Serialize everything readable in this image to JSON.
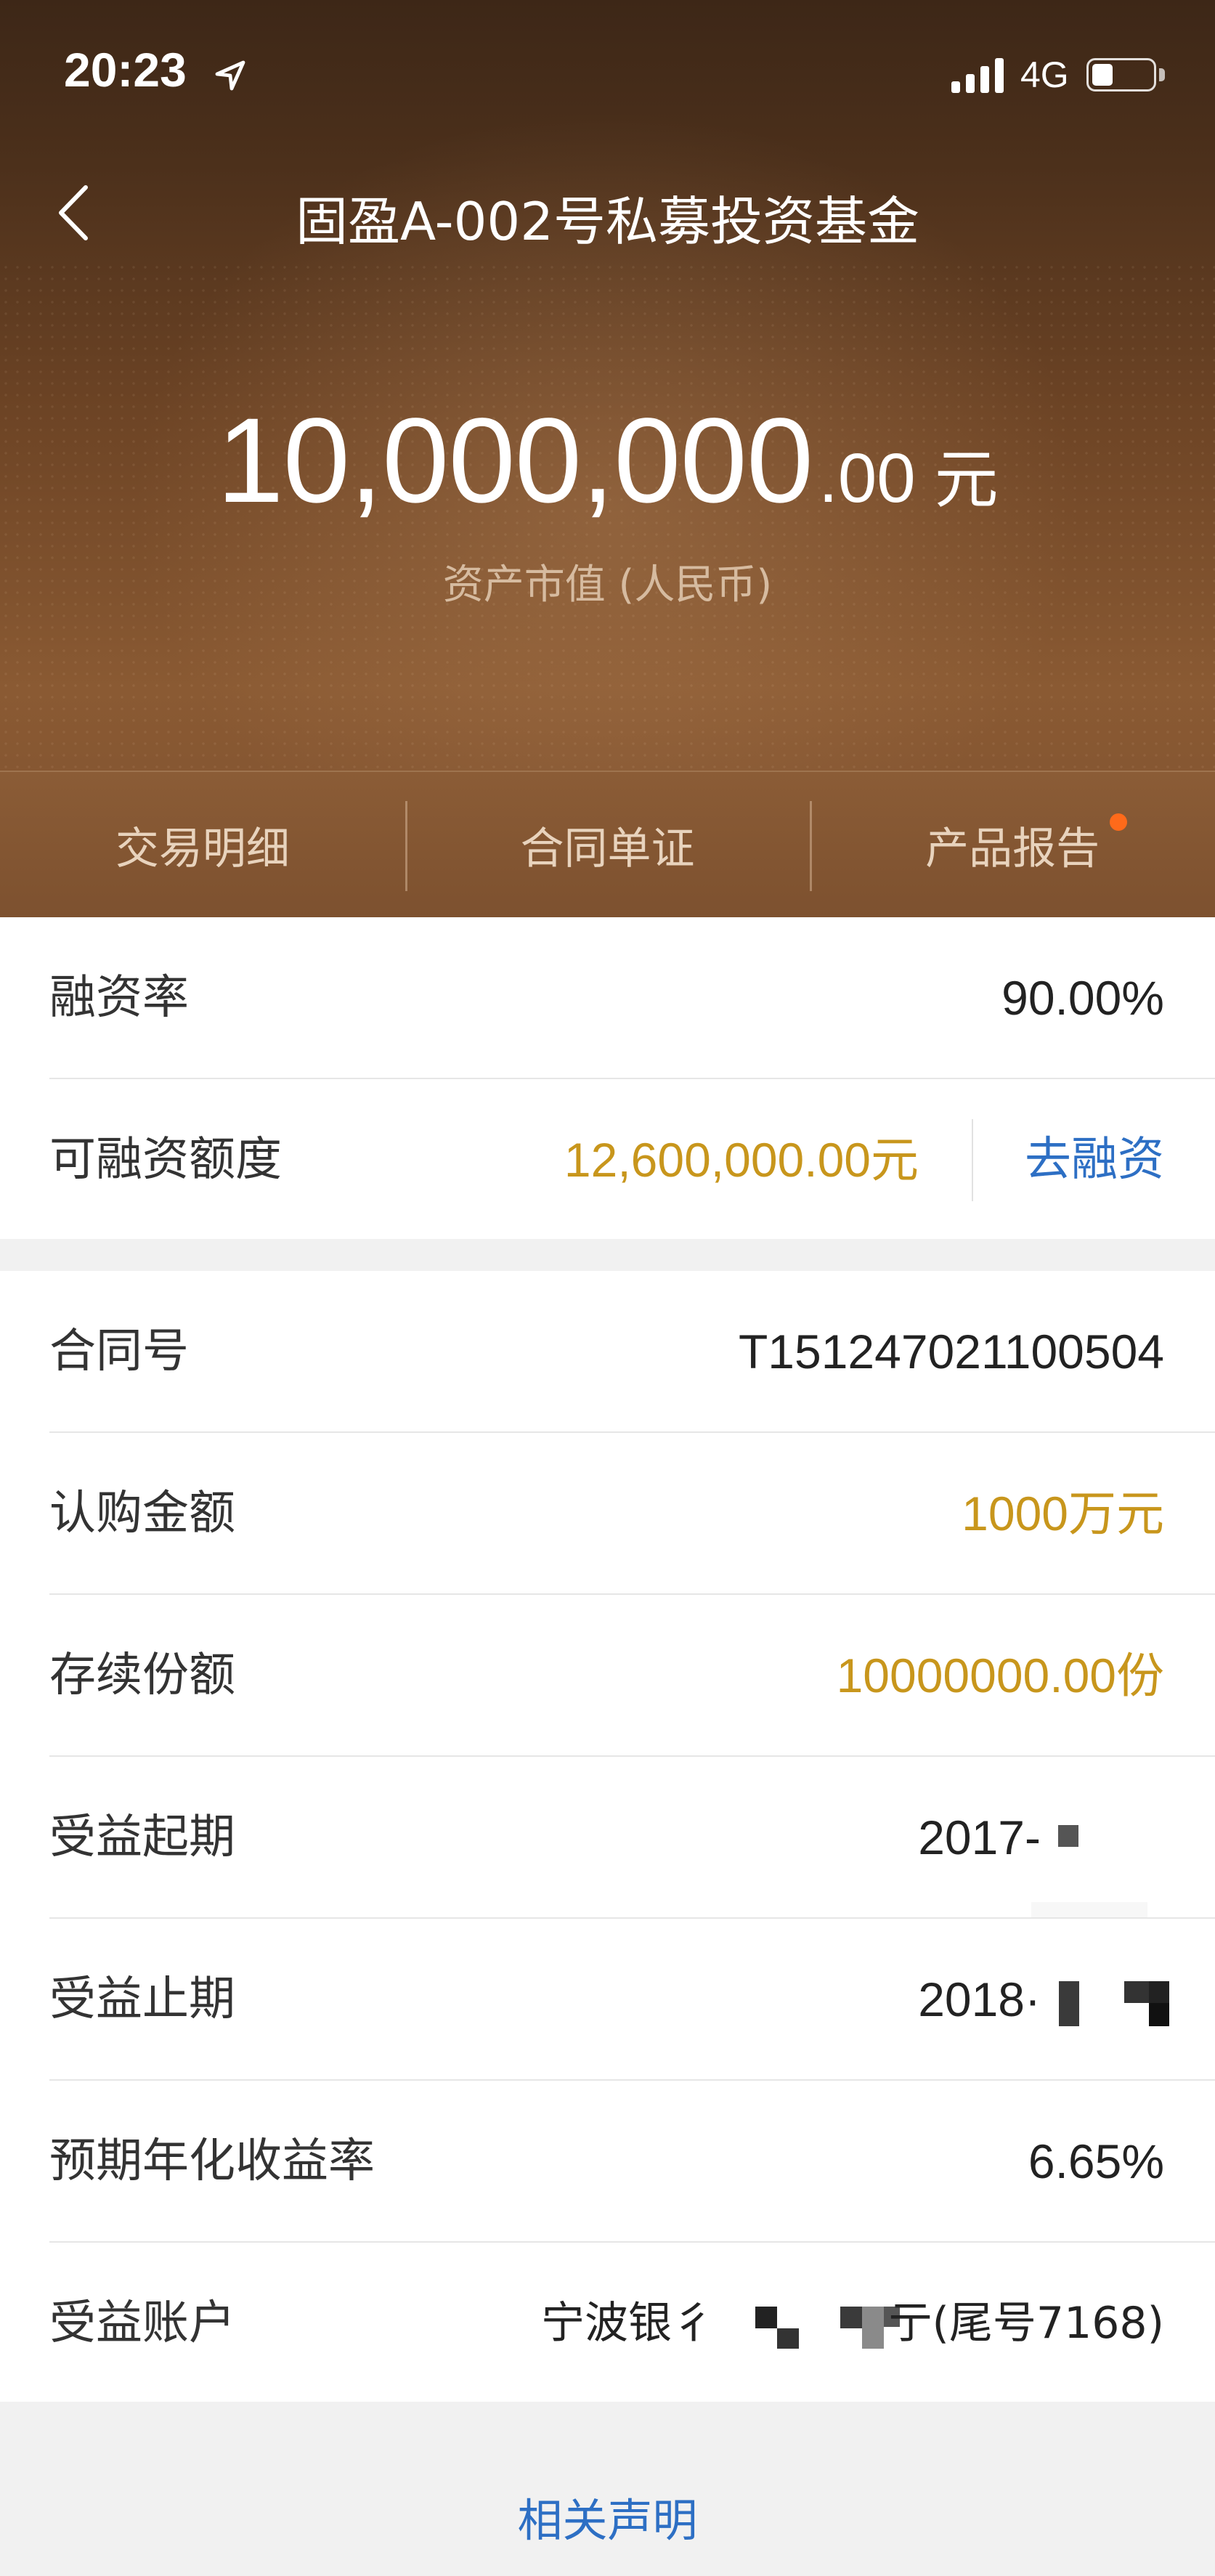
{
  "status_bar": {
    "time": "20:23",
    "network": "4G",
    "icons": [
      "location-arrow-icon",
      "signal-icon",
      "battery-icon"
    ]
  },
  "nav": {
    "title": "固盈A-002号私募投资基金",
    "back_icon": "chevron-left-icon"
  },
  "hero": {
    "amount_integer": "10,000,000",
    "amount_decimal": ".00",
    "amount_unit": "元",
    "amount_label": "资产市值 (人民币)"
  },
  "tabs": [
    {
      "label": "交易明细"
    },
    {
      "label": "合同单证"
    },
    {
      "label": "产品报告",
      "has_badge": true
    }
  ],
  "financing": {
    "rate_label": "融资率",
    "rate_value": "90.00%",
    "credit_label": "可融资额度",
    "credit_value": "12,600,000.00元",
    "action_label": "去融资"
  },
  "details": {
    "contract_label": "合同号",
    "contract_value": "T151247021100504",
    "subscription_label": "认购金额",
    "subscription_value": "1000万元",
    "shares_label": "存续份额",
    "shares_value": "10000000.00份",
    "start_label": "受益起期",
    "start_value": "2017-",
    "end_label": "受益止期",
    "end_value": "2018·",
    "yield_label": "预期年化收益率",
    "yield_value": "6.65%",
    "account_label": "受益账户",
    "account_prefix": "宁波银彳",
    "account_suffix": "亍(尾号7168)"
  },
  "footer": {
    "link_label": "相关声明"
  },
  "colors": {
    "accent_gold": "#c8961c",
    "link_blue": "#2d6fc4",
    "badge_orange": "#ff6a1a",
    "hero_brown": "#6d4425"
  }
}
